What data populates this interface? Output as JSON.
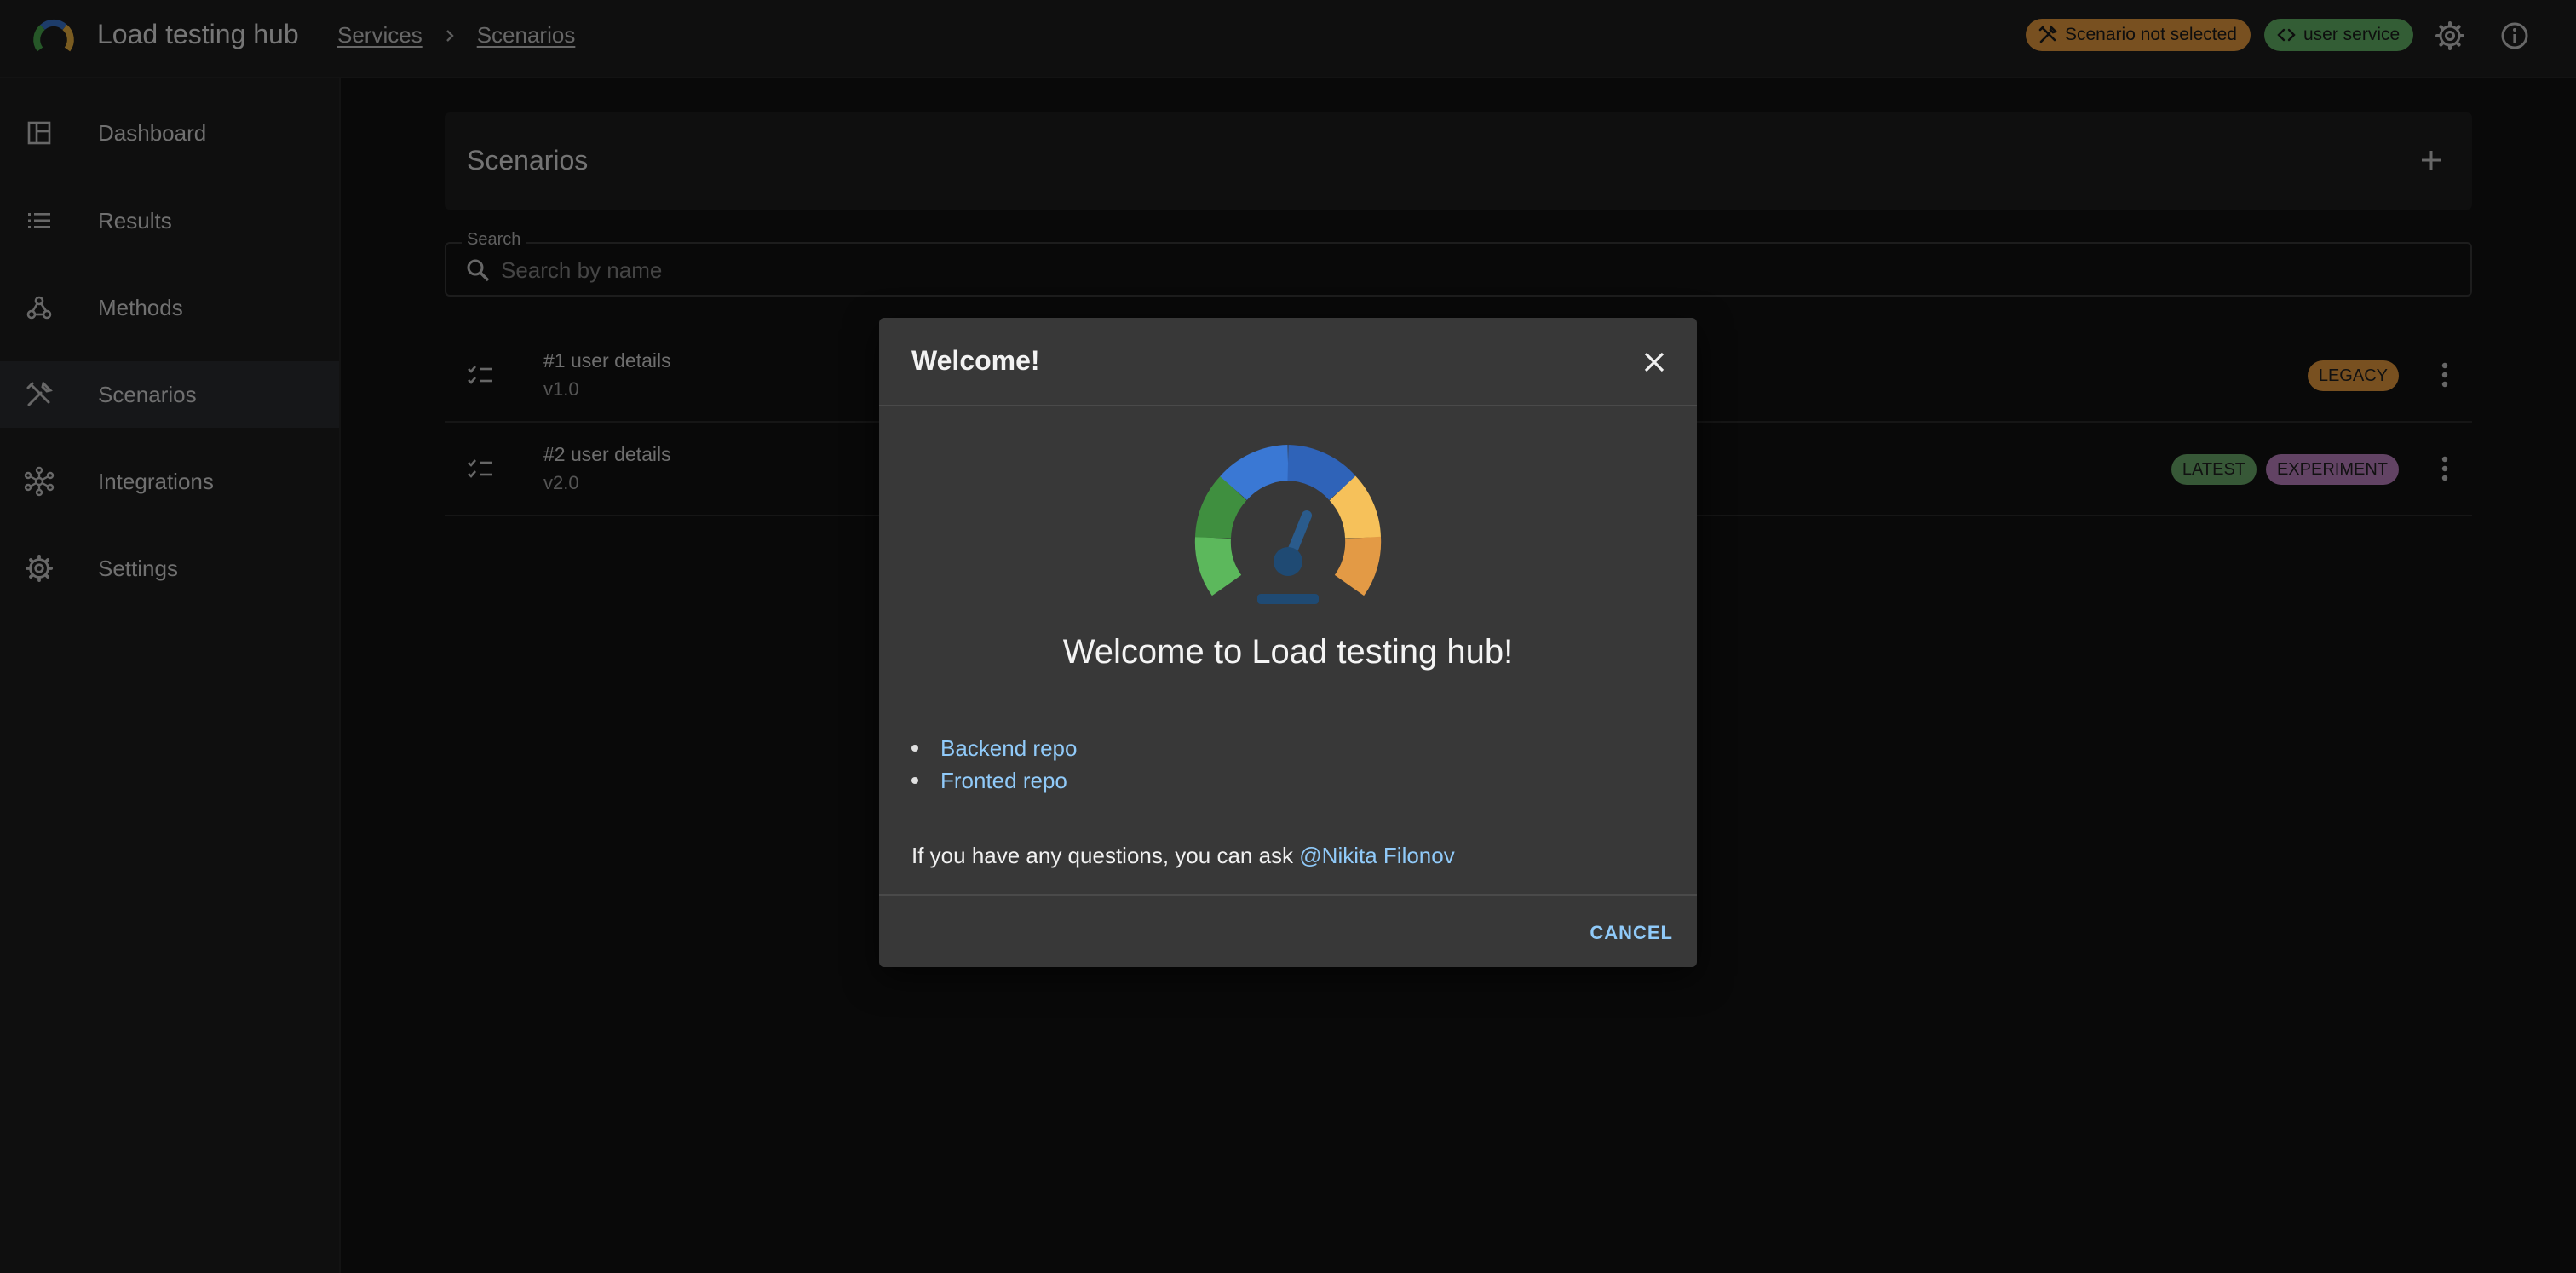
{
  "app": {
    "title": "Load testing hub"
  },
  "breadcrumbs": [
    "Services",
    "Scenarios"
  ],
  "header": {
    "scenario_chip": "Scenario not selected",
    "service_chip": "user service",
    "settings_icon": "gear-icon",
    "info_icon": "info-icon"
  },
  "sidebar": {
    "items": [
      {
        "label": "Dashboard",
        "icon": "dashboard-icon"
      },
      {
        "label": "Results",
        "icon": "list-icon"
      },
      {
        "label": "Methods",
        "icon": "webhook-icon"
      },
      {
        "label": "Scenarios",
        "icon": "tools-icon",
        "active": true
      },
      {
        "label": "Integrations",
        "icon": "hub-icon"
      },
      {
        "label": "Settings",
        "icon": "gear-icon"
      }
    ]
  },
  "main": {
    "title": "Scenarios",
    "search": {
      "label": "Search",
      "placeholder": "Search by name",
      "value": ""
    },
    "rows": [
      {
        "title": "#1 user details",
        "version": "v1.0",
        "tags": [
          "LEGACY"
        ]
      },
      {
        "title": "#2 user details",
        "version": "v2.0",
        "tags": [
          "LATEST",
          "EXPERIMENT"
        ]
      }
    ]
  },
  "dialog": {
    "title": "Welcome!",
    "heading": "Welcome to Load testing hub!",
    "links": [
      "Backend repo",
      "Fronted repo"
    ],
    "question_text": "If you have any questions, you can ask ",
    "contact": "@Nikita Filonov",
    "cancel_label": "CANCEL"
  },
  "colors": {
    "accent_link": "#90caf9",
    "warning_chip": "#f0a040",
    "success_chip": "#66bb6a",
    "experiment_tag": "#c586c8"
  }
}
